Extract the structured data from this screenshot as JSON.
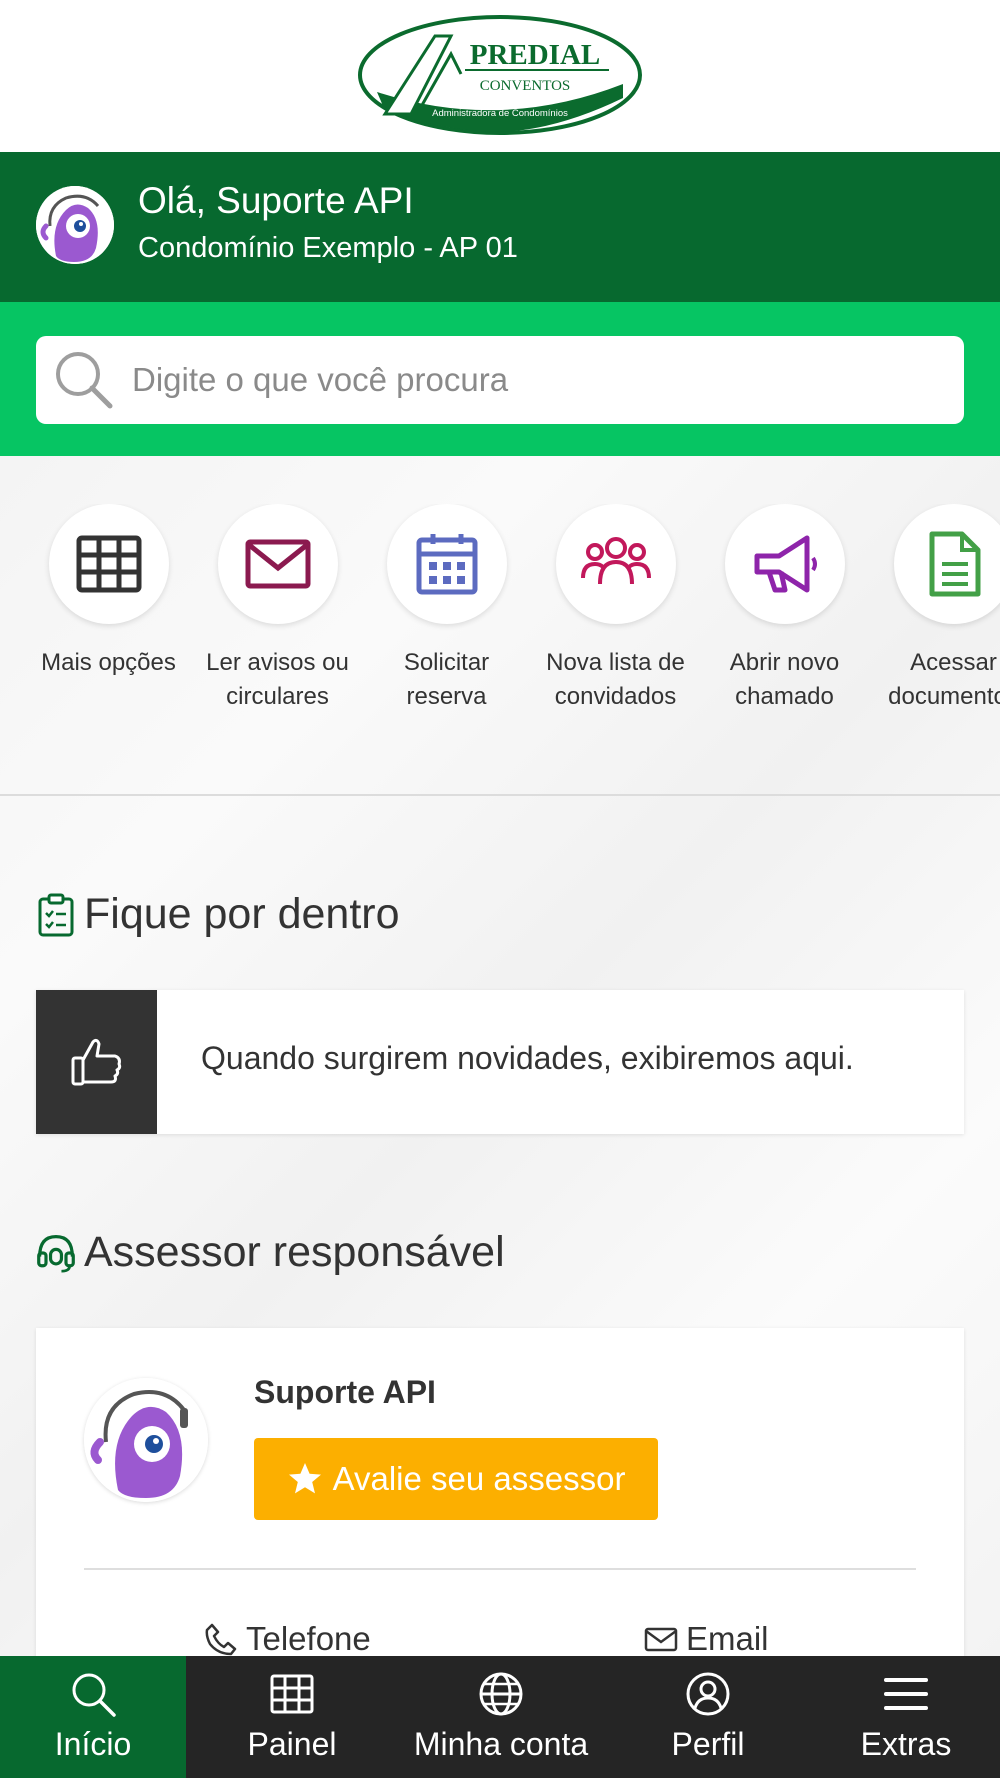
{
  "header": {
    "logo_text": "PREDIAL",
    "logo_sub": "CONVENTOS",
    "logo_tagline": "Administradora de Condomínios"
  },
  "greeting": {
    "hello": "Olá, Suporte API",
    "condo": "Condomínio Exemplo - AP 01"
  },
  "search": {
    "placeholder": "Digite o que você procura"
  },
  "quick_actions": [
    {
      "label": "Mais opções",
      "icon": "grid-icon",
      "color": "#333333"
    },
    {
      "label": "Ler avisos ou circulares",
      "icon": "envelope-icon",
      "color": "#8b1a4f"
    },
    {
      "label": "Solicitar reserva",
      "icon": "calendar-icon",
      "color": "#5c6bc0"
    },
    {
      "label": "Nova lista de convidados",
      "icon": "users-icon",
      "color": "#c2185b"
    },
    {
      "label": "Abrir novo chamado",
      "icon": "megaphone-icon",
      "color": "#8e24aa"
    },
    {
      "label": "Acessar documentos",
      "icon": "document-icon",
      "color": "#43a047"
    }
  ],
  "news": {
    "title": "Fique por dentro",
    "empty_message": "Quando surgirem novidades, exibiremos aqui."
  },
  "advisor": {
    "title": "Assessor responsável",
    "name": "Suporte API",
    "rate_button": "Avalie seu assessor",
    "phone_label": "Telefone",
    "email_label": "Email"
  },
  "bottom_nav": [
    {
      "label": "Início",
      "icon": "search-icon",
      "active": true
    },
    {
      "label": "Painel",
      "icon": "grid-icon",
      "active": false
    },
    {
      "label": "Minha conta",
      "icon": "globe-icon",
      "active": false
    },
    {
      "label": "Perfil",
      "icon": "user-circle-icon",
      "active": false
    },
    {
      "label": "Extras",
      "icon": "menu-icon",
      "active": false
    }
  ],
  "colors": {
    "header_green": "#07692f",
    "search_green": "#06c563",
    "accent_yellow": "#fcaf00",
    "nav_dark": "#252525"
  }
}
